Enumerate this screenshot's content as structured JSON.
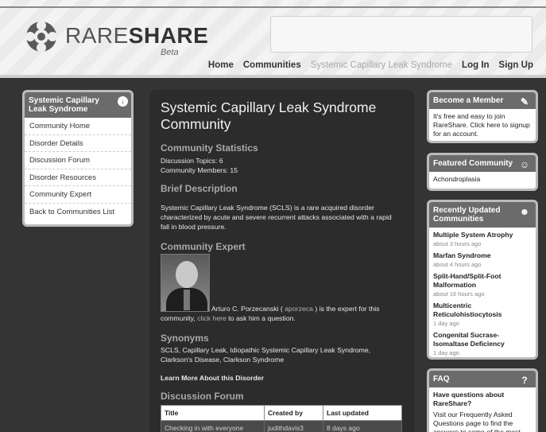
{
  "header": {
    "logo_light": "RARE",
    "logo_bold": "SHARE",
    "logo_beta": "Beta",
    "nav": [
      {
        "label": "Home"
      },
      {
        "label": "Communities"
      },
      {
        "label": "Systemic Capillary Leak Syndrome"
      },
      {
        "label": "Log In"
      },
      {
        "label": "Sign Up"
      }
    ]
  },
  "sidebar": {
    "title": "Systemic Capillary Leak Syndrome",
    "items": [
      {
        "label": "Community Home"
      },
      {
        "label": "Disorder Details"
      },
      {
        "label": "Discussion Forum"
      },
      {
        "label": "Disorder Resources"
      },
      {
        "label": "Community Expert"
      },
      {
        "label": "Back to Communities List"
      }
    ]
  },
  "main": {
    "title": "Systemic Capillary Leak Syndrome Community",
    "stats_heading": "Community Statistics",
    "stats_topics": "Discussion Topics: 6",
    "stats_members": "Community Members: 15",
    "brief_heading": "Brief Description",
    "brief_text": "Systemic Capillary Leak Syndrome (SCLS) is a rare acquired disorder characterized by acute and severe recurrent attacks associated with a rapid fall in blood pressure.",
    "expert_heading": "Community Expert",
    "expert_text_1": "Arturo C. Porzecanski ( ",
    "expert_username": "aporzeca",
    "expert_text_2": " ) is the expert for this community, ",
    "expert_link": "click here",
    "expert_text_3": " to ask him a question.",
    "synonyms_heading": "Synonyms",
    "synonyms_text": "SCLS, Capillary Leak, Idiopathic Systemic Capillary Leak Syndrome, Clarkson's Disease, Clarkson Syndrome",
    "learn_more": "Learn More About this Disorder",
    "forum_heading": "Discussion Forum",
    "forum_columns": [
      "Title",
      "Created by",
      "Last updated"
    ],
    "forum_rows": [
      {
        "title": "Checking in with everyone",
        "created_by": "judithdavis3",
        "updated": "8 days ago"
      }
    ]
  },
  "right": {
    "member_title": "Become a Member",
    "member_text": "It's free and easy to join RareShare. Click here to signup for an account.",
    "featured_title": "Featured Community",
    "featured_item": "Achondroplasia",
    "updated_title": "Recently Updated Communities",
    "updated_items": [
      {
        "title": "Multiple System Atrophy",
        "time": "about 3 hours ago"
      },
      {
        "title": "Marfan Syndrome",
        "time": "about 4 hours ago"
      },
      {
        "title": "Split-Hand/Split-Foot Malformation",
        "time": "about 16 hours ago"
      },
      {
        "title": "Multicentric Reticulohistiocytosis",
        "time": "1 day ago"
      },
      {
        "title": "Congenital Sucrase-Isomaltase Deficiency",
        "time": "1 day ago"
      }
    ],
    "faq_title": "FAQ",
    "faq_question": "Have questions about RareShare?",
    "faq_text": "Visit our Frequently Asked Questions page to find the answers to some of the most"
  },
  "icons": {
    "logo": "gear-logo-icon",
    "sidebar_toggle": "circle-arrow-down-icon",
    "member": "pencil-note-icon",
    "featured": "people-icon",
    "updated": "people-group-icon",
    "faq": "question-icon"
  }
}
